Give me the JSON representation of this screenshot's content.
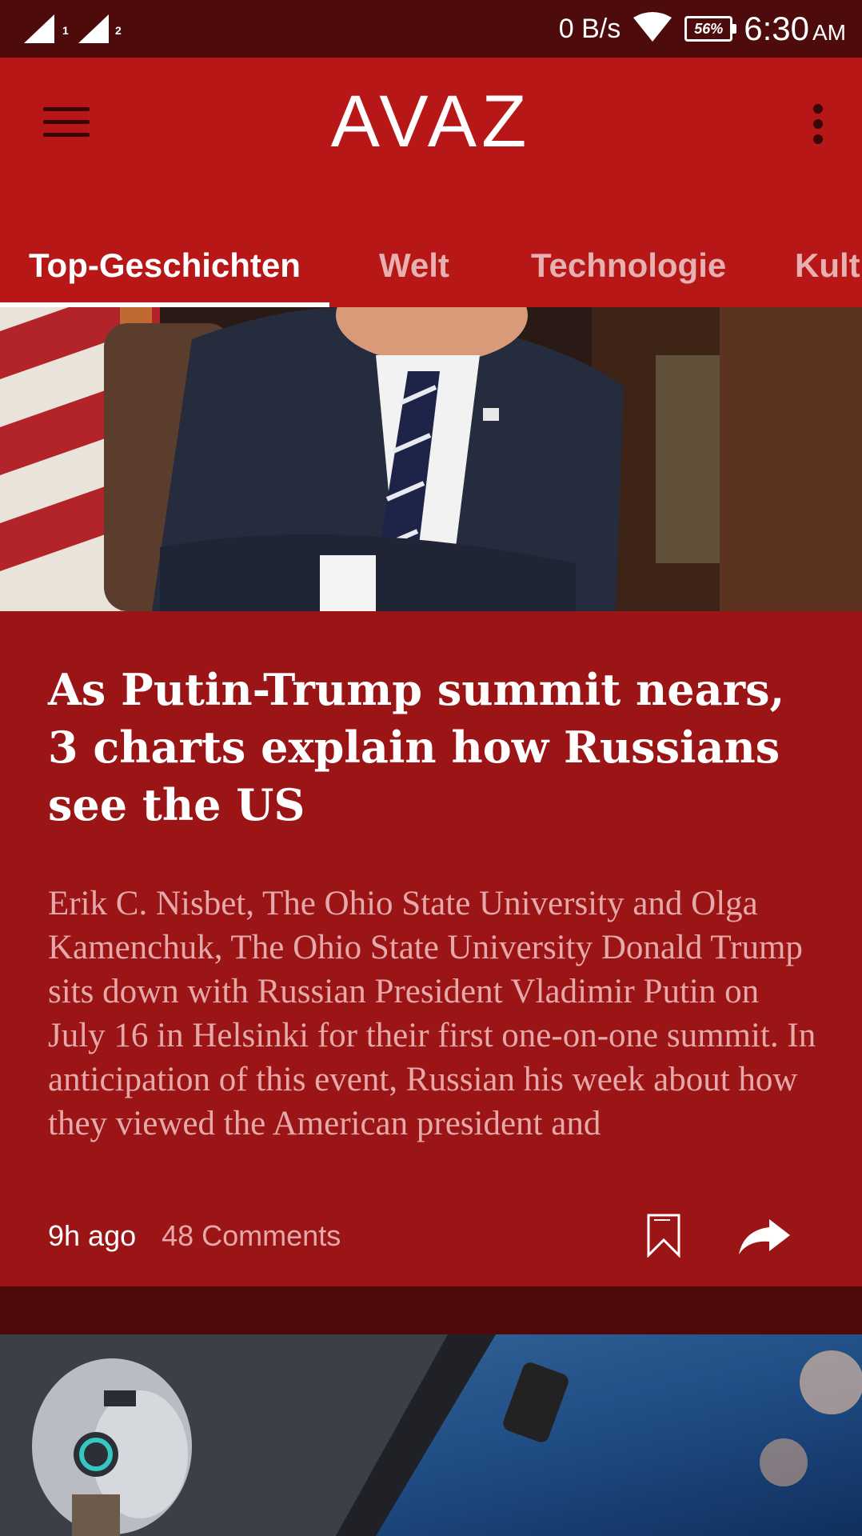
{
  "status_bar": {
    "sim1": "1",
    "sim2": "2",
    "network_speed": "0 B/s",
    "battery": "56%",
    "time": "6:30",
    "ampm": "AM"
  },
  "app": {
    "logo": "AVAZ"
  },
  "tabs": [
    {
      "label": "Top-Geschichten",
      "active": true
    },
    {
      "label": "Welt",
      "active": false
    },
    {
      "label": "Technologie",
      "active": false
    },
    {
      "label": "Kultur",
      "active": false
    }
  ],
  "article": {
    "headline": "As Putin-Trump summit nears, 3 charts explain how Russians see the US",
    "summary": "Erik C. Nisbet, The Ohio State University and Olga Kamenchuk, The Ohio State University Donald Trump sits down with Russian President Vladimir Putin on July 16 in Helsinki for their first one-on-one summit. In anticipation of this event, Russian his week about how they viewed the American president and",
    "age": "9h ago",
    "comments": "48 Comments"
  },
  "colors": {
    "statusbar": "#4e0b0c",
    "appbar": "#b71817",
    "card": "#9b1516",
    "divider": "#4d0a0b"
  }
}
